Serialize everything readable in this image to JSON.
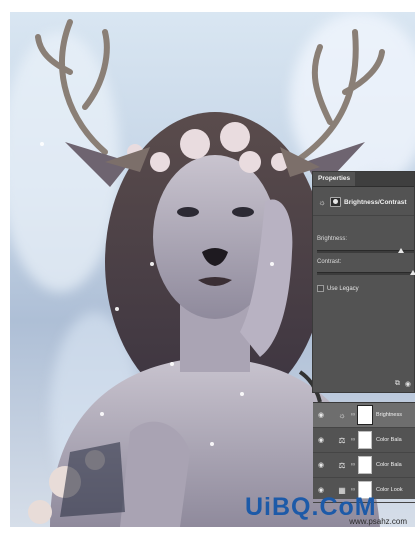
{
  "properties_panel": {
    "tab_label": "Properties",
    "adjustment_title": "Brightness/Contrast",
    "brightness_label": "Brightness:",
    "contrast_label": "Contrast:",
    "use_legacy_label": "Use Legacy",
    "use_legacy_checked": false,
    "brightness_value_fraction": 0.87,
    "contrast_value_fraction": 0.99
  },
  "layers_panel": {
    "layers": [
      {
        "icon": "brightness-contrast-icon",
        "name": "Brightness",
        "selected": true
      },
      {
        "icon": "color-balance-icon",
        "name": "Color Bala",
        "selected": false
      },
      {
        "icon": "color-balance-icon",
        "name": "Color Bala",
        "selected": false
      },
      {
        "icon": "color-lookup-icon",
        "name": "Color Look",
        "selected": false
      }
    ]
  },
  "watermark": {
    "logo_text": "UiBQ.CoM",
    "url_text": "www.psahz.com"
  },
  "colors": {
    "panel_bg": "#535353",
    "selected_layer": "#6e6e6e",
    "watermark_blue": "#1d5aa8"
  }
}
